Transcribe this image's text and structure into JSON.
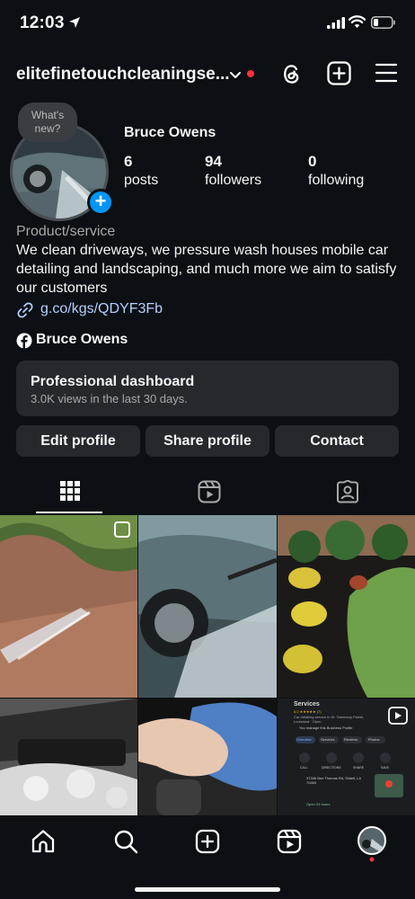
{
  "status_bar": {
    "time": "12:03"
  },
  "header": {
    "username": "elitefinetouchcleaningse..."
  },
  "profile": {
    "notes_bubble": "What's new?",
    "display_name": "Bruce Owens",
    "stats": [
      {
        "value": "6",
        "label": "posts"
      },
      {
        "value": "94",
        "label": "followers"
      },
      {
        "value": "0",
        "label": "following"
      }
    ],
    "category": "Product/service",
    "bio": "We clean driveways, we pressure wash houses mobile car detailing and landscaping, and much more we aim to satisfy our customers",
    "link": "g.co/kgs/QDYF3Fb",
    "facebook_name": "Bruce Owens"
  },
  "dashboard": {
    "title": "Professional dashboard",
    "subtitle": "3.0K views in the last 30 days."
  },
  "buttons": {
    "edit": "Edit profile",
    "share": "Share profile",
    "contact": "Contact"
  },
  "maps_thumb": {
    "title": "Services",
    "rating": "5.0 ★★★★★ (7)",
    "desc": "Car detailing service in St. Tammany Parish, Louisiana · Open",
    "manage": "You manage this Business Profile",
    "tabs": [
      "Overview",
      "Services",
      "Reviews",
      "Photos"
    ],
    "actions": [
      "CALL",
      "DIRECTIONS",
      "SHARE",
      "SAVE"
    ],
    "address": "37346 Ben Thomas Rd, Slidell, LA 70460",
    "hours": "Open 24 hours"
  },
  "colors": {
    "background": "#0c1014",
    "accent_blue": "#0095f6",
    "notification_red": "#ff3040",
    "button_bg": "#25292e"
  }
}
